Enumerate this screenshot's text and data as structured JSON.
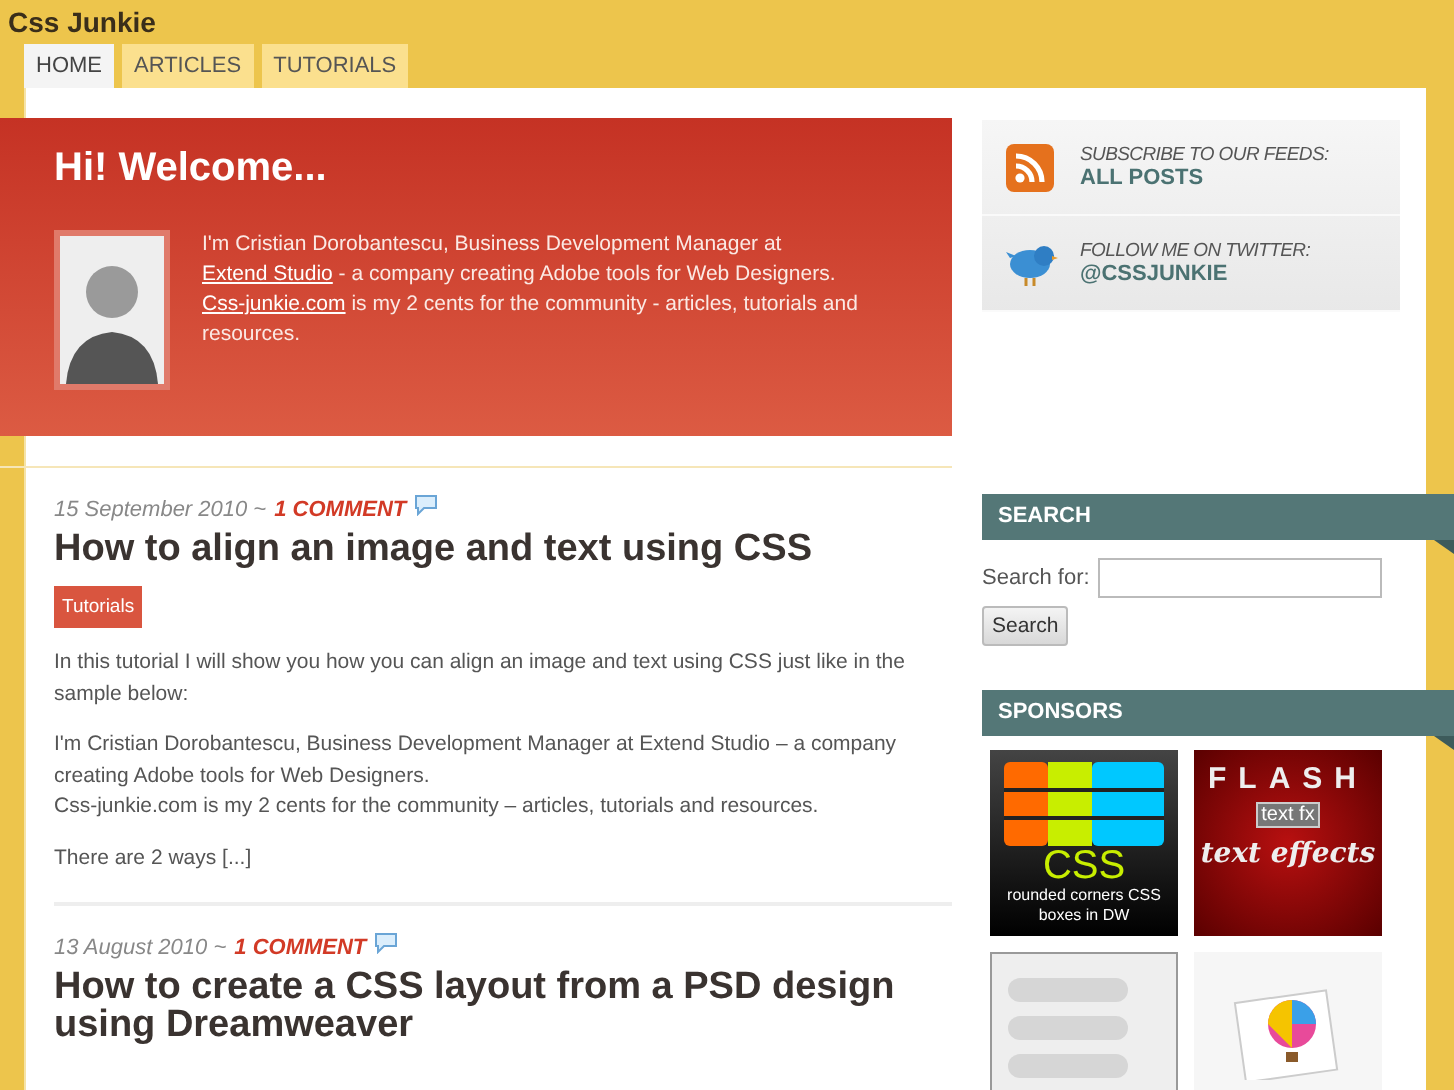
{
  "site_title": "Css Junkie",
  "nav": [
    {
      "label": "HOME",
      "selected": true
    },
    {
      "label": "ARTICLES",
      "selected": false
    },
    {
      "label": "TUTORIALS",
      "selected": false
    }
  ],
  "welcome": {
    "heading": "Hi! Welcome...",
    "bio": [
      {
        "text": "I'm Cristian Dorobantescu, Business Development Manager at ",
        "kind": "text"
      },
      {
        "text": "Extend Studio",
        "kind": "link"
      },
      {
        "text": " - a company creating Adobe tools for Web Designers. ",
        "kind": "text"
      },
      {
        "text": "Css-junkie.com",
        "kind": "link"
      },
      {
        "text": " is my 2 cents for the community - articles, tutorials and resources.",
        "kind": "text"
      }
    ]
  },
  "feeds": [
    {
      "kind": "rss",
      "caption": "SUBSCRIBE TO OUR FEEDS:",
      "link": "ALL POSTS"
    },
    {
      "kind": "twitter",
      "caption": "FOLLOW ME ON TWITTER:",
      "link": "@CSSJUNKIE"
    }
  ],
  "posts": [
    {
      "date": "15 September 2010 ~",
      "comments": "1 COMMENT",
      "title": "How to align an image and text using CSS",
      "tag": "Tutorials",
      "paragraphs": [
        "In this tutorial I will show you how you can align an image and text using CSS just like in the sample below:",
        "I'm Cristian Dorobantescu, Business Development Manager at Extend Studio – a company creating Adobe tools for Web Designers.\nCss-junkie.com is my 2 cents for the community – articles, tutorials and resources.",
        "There are 2 ways [...]"
      ]
    },
    {
      "date": "13 August 2010 ~",
      "comments": "1 COMMENT",
      "title": "How to create a CSS layout from a PSD design using Dreamweaver"
    }
  ],
  "search": {
    "heading": "SEARCH",
    "label": "Search for:",
    "button": "Search"
  },
  "sponsors": {
    "heading": "SPONSORS",
    "ads": [
      {
        "kind": "css",
        "texts": [
          "CSS",
          "rounded corners CSS boxes in DW"
        ]
      },
      {
        "kind": "flash",
        "texts": [
          "FLASH",
          "text fx",
          "text effects"
        ]
      },
      {
        "kind": "lines"
      },
      {
        "kind": "balloon"
      }
    ]
  }
}
